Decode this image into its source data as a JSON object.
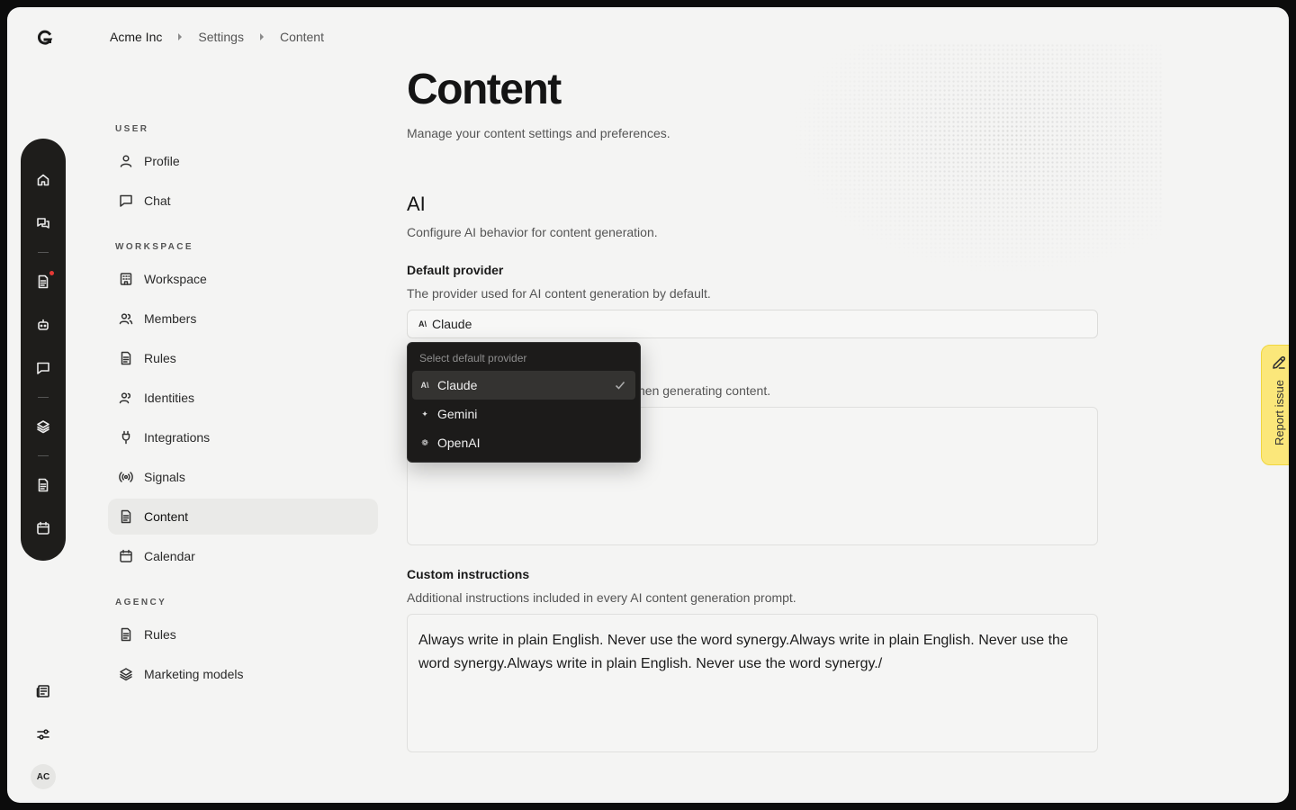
{
  "breadcrumb": [
    "Acme Inc",
    "Settings",
    "Content"
  ],
  "rail": {
    "items": [
      {
        "icon": "home-icon"
      },
      {
        "icon": "chats-icon"
      },
      {
        "icon": "document-icon",
        "badge": true
      },
      {
        "icon": "bot-icon"
      },
      {
        "icon": "message-icon"
      },
      {
        "icon": "layers-icon"
      },
      {
        "icon": "file-icon"
      },
      {
        "icon": "calendar-icon"
      }
    ]
  },
  "bottom": {
    "avatar_initials": "AC"
  },
  "settings_nav": {
    "user_title": "USER",
    "user_items": [
      "Profile",
      "Chat"
    ],
    "workspace_title": "WORKSPACE",
    "workspace_items": [
      "Workspace",
      "Members",
      "Rules",
      "Identities",
      "Integrations",
      "Signals",
      "Content",
      "Calendar"
    ],
    "agency_title": "AGENCY",
    "agency_items": [
      "Rules",
      "Marketing models"
    ],
    "active": "Content"
  },
  "page": {
    "title": "Content",
    "subtitle": "Manage your content settings and preferences."
  },
  "ai": {
    "title": "AI",
    "subtitle": "Configure AI behavior for content generation.",
    "provider_label": "Default provider",
    "provider_desc": "The provider used for AI content generation by default.",
    "provider_value": "Claude",
    "provider_mark": "A\\",
    "second_desc_visible": "hen generating content.",
    "custom_label": "Custom instructions",
    "custom_desc": "Additional instructions included in every AI content generation prompt.",
    "custom_value": "Always write in plain English. Never use the word synergy.Always write in plain English. Never use the word synergy.Always write in plain English. Never use the word synergy./"
  },
  "dropdown": {
    "title": "Select default provider",
    "options": [
      {
        "label": "Claude",
        "mark": "A\\",
        "selected": true
      },
      {
        "label": "Gemini",
        "mark": "✦",
        "selected": false
      },
      {
        "label": "OpenAI",
        "mark": "❁",
        "selected": false
      }
    ]
  },
  "report": {
    "label": "Report issue"
  }
}
